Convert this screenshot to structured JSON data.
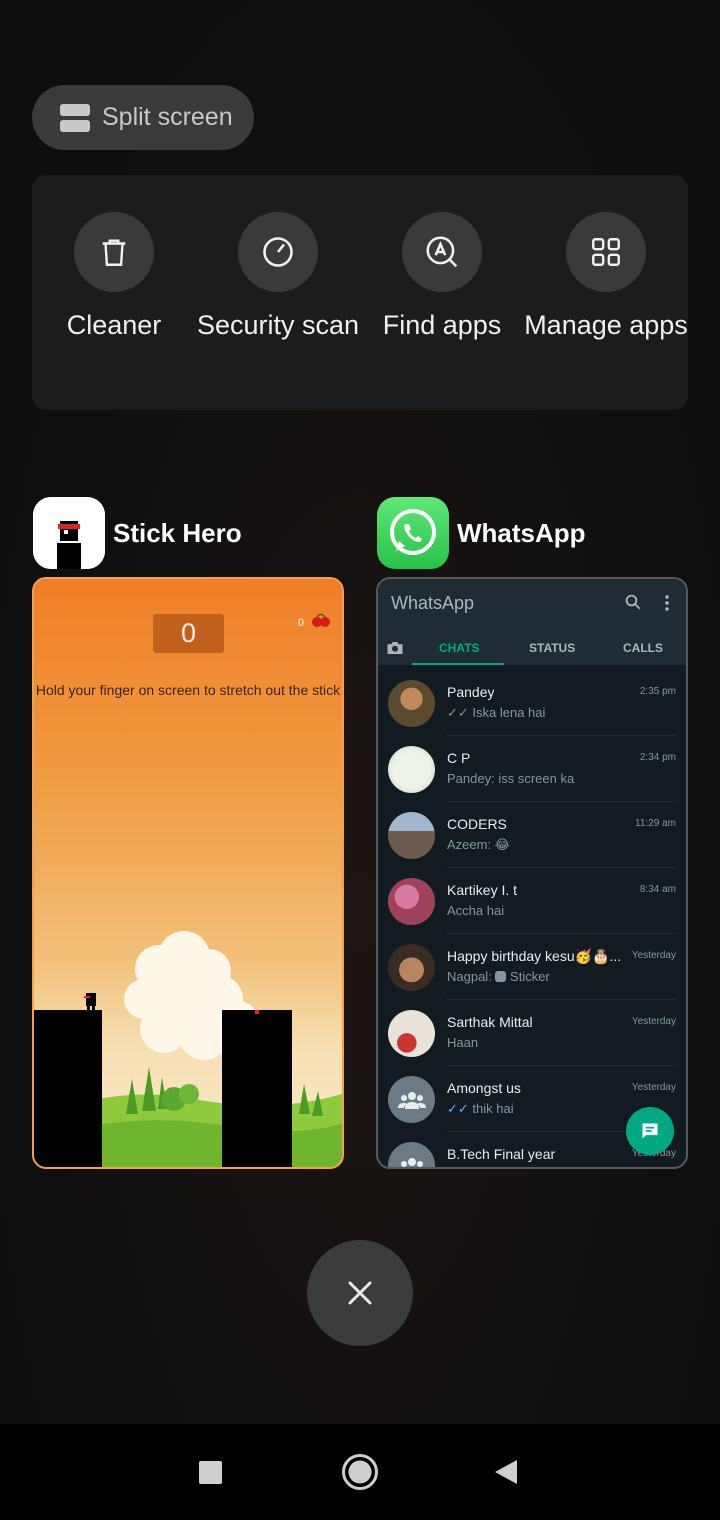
{
  "split_screen": {
    "label": "Split screen"
  },
  "tools": [
    {
      "label": "Cleaner",
      "icon": "trash-icon"
    },
    {
      "label": "Security scan",
      "icon": "gauge-icon"
    },
    {
      "label": "Find apps",
      "icon": "search-app-icon"
    },
    {
      "label": "Manage apps",
      "icon": "grid-icon"
    }
  ],
  "apps": {
    "stick_hero": {
      "name": "Stick Hero",
      "score": "0",
      "cherries": "0",
      "hint": "Hold your finger on screen to stretch out the stick"
    },
    "whatsapp": {
      "name": "WhatsApp",
      "title": "WhatsApp",
      "tabs": {
        "chats": "CHATS",
        "status": "STATUS",
        "calls": "CALLS"
      },
      "chats": [
        {
          "name": "Pandey",
          "message": "Iska lena hai",
          "time": "2:35 pm",
          "ticks": true,
          "avatar_color": "#5b4a2e"
        },
        {
          "name": "C P",
          "message": "Pandey: iss screen ka",
          "time": "2:34 pm",
          "ticks": false,
          "avatar_color": "#d9e4d2"
        },
        {
          "name": "CODERS",
          "message": "Azeem: 😂",
          "time": "11:29 am",
          "ticks": false,
          "avatar_color": "#7b8fa3"
        },
        {
          "name": "Kartikey I. t",
          "message": "Accha hai",
          "time": "8:34 am",
          "ticks": false,
          "avatar_color": "#a1425d"
        },
        {
          "name": "Happy birthday kesu🥳🎂...",
          "message": "Nagpal: Sticker",
          "time": "Yesterday",
          "ticks": false,
          "avatar_color": "#6d5a48"
        },
        {
          "name": "Sarthak Mittal",
          "message": "Haan",
          "time": "Yesterday",
          "ticks": false,
          "avatar_color": "#c9b9a6"
        },
        {
          "name": "Amongst us",
          "message": "thik hai",
          "time": "Yesterday",
          "ticks": true,
          "avatar_color": "#6b7a84"
        },
        {
          "name": "B.Tech Final year",
          "message": "",
          "time": "Yesterday",
          "ticks": false,
          "avatar_color": "#6b7a84"
        }
      ]
    }
  },
  "colors": {
    "wa_accent": "#00a884",
    "stick_orange": "#ef7f27"
  }
}
